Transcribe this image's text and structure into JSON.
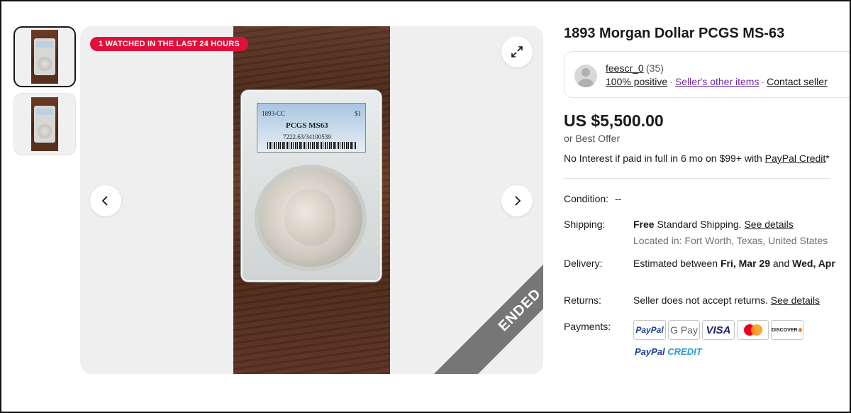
{
  "thumbnails": [
    {
      "label": "PCGS"
    },
    {
      "label": "PCGS"
    }
  ],
  "gallery": {
    "watch_badge": "1 WATCHED IN THE LAST 24 HOURS",
    "ended_ribbon": "ENDED",
    "slab": {
      "date": "1893-CC",
      "denomination": "$1",
      "grade": "PCGS MS63",
      "cert": "7222.63/34100539"
    },
    "icons": {
      "expand": "expand-icon",
      "prev": "chevron-left-icon",
      "next": "chevron-right-icon"
    }
  },
  "listing": {
    "title": "1893 Morgan Dollar PCGS MS-63",
    "seller": {
      "name": "feescr_0",
      "feedback_count": "(35)",
      "positive": "100% positive",
      "other_items": "Seller's other items",
      "contact": "Contact seller"
    },
    "price": "US $5,500.00",
    "best_offer": "or Best Offer",
    "credit_text": "No Interest if paid in full in 6 mo on $99+ with ",
    "credit_link": "PayPal Credit",
    "credit_suffix": "*",
    "condition": {
      "label": "Condition:",
      "value": "--"
    },
    "shipping": {
      "label": "Shipping:",
      "free": "Free",
      "text": " Standard Shipping. ",
      "link": "See details",
      "location": "Located in: Fort Worth, Texas, United States"
    },
    "delivery": {
      "label": "Delivery:",
      "text": "Estimated between ",
      "from": "Fri, Mar 29",
      "and": " and ",
      "to": "Wed, Apr"
    },
    "returns": {
      "label": "Returns:",
      "text": "Seller does not accept returns. ",
      "link": "See details"
    },
    "payments": {
      "label": "Payments:",
      "paypal": "PayPal",
      "gpay": "G Pay",
      "visa": "VISA",
      "discover": "DISCOVER",
      "credit_p1": "PayPal",
      "credit_p2": " CREDIT"
    }
  },
  "colors": {
    "badge": "#e0103a",
    "link_purple": "#6f2da8",
    "ribbon": "#767676"
  }
}
